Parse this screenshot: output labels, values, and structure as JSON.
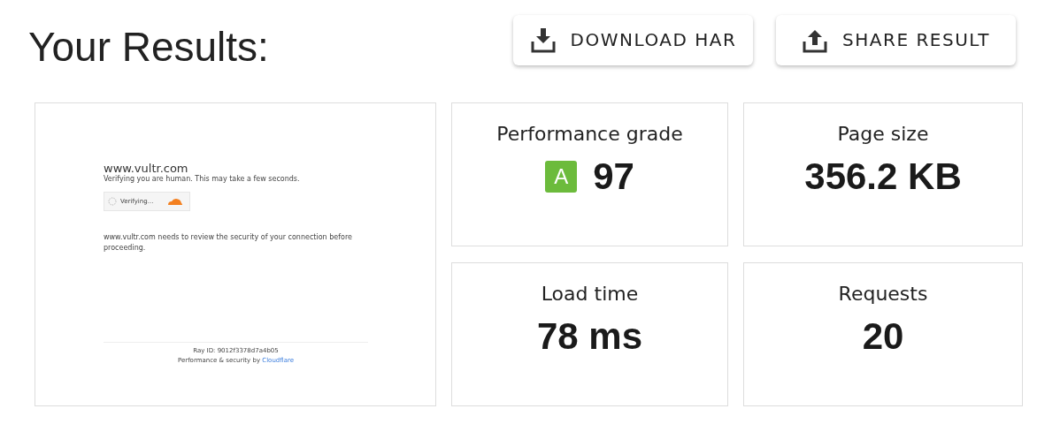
{
  "title": "Your Results:",
  "buttons": [
    {
      "kind": "download",
      "label": "DOWNLOAD HAR"
    },
    {
      "kind": "share",
      "label": "SHARE RESULT"
    }
  ],
  "preview": {
    "site": "www.vultr.com",
    "subtitle": "Verifying you are human. This may take a few seconds.",
    "widget_label": "Verifying...",
    "message": "www.vultr.com needs to review the security of your connection before proceeding.",
    "ray_id": "Ray ID: 9012f3378d7a4b05",
    "footer": "Performance & security by",
    "footer_link": "Cloudflare"
  },
  "metrics": [
    {
      "label": "Performance grade",
      "grade": "A",
      "value": "97"
    },
    {
      "label": "Page size",
      "value": "356.2 KB"
    },
    {
      "label": "Load time",
      "value": "78 ms"
    },
    {
      "label": "Requests",
      "value": "20"
    }
  ]
}
